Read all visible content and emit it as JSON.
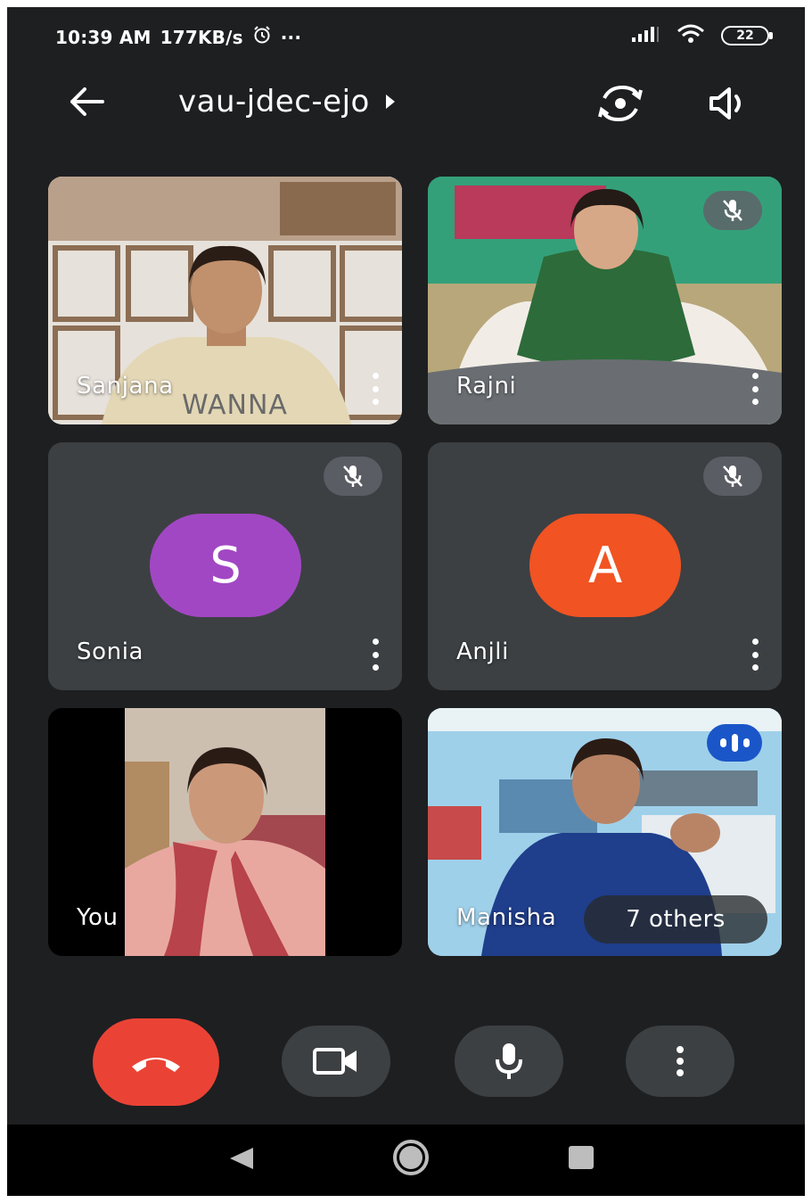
{
  "status_bar": {
    "time": "10:39 AM",
    "net_speed": "177KB/s",
    "more": "···",
    "battery": "22"
  },
  "top_bar": {
    "meeting_code": "vau-jdec-ejo"
  },
  "tiles": [
    {
      "name": "Sanjana",
      "shirt_text": "WANNA",
      "muted": false
    },
    {
      "name": "Rajni",
      "muted": true
    },
    {
      "name": "Sonia",
      "initial": "S",
      "avatar_color": "#a247c4",
      "muted": true
    },
    {
      "name": "Anjli",
      "initial": "A",
      "avatar_color": "#f15323",
      "muted": true
    },
    {
      "name": "You"
    },
    {
      "name": "Manisha",
      "speaking": true,
      "others_label": "7 others"
    }
  ],
  "colors": {
    "background": "#1e1f21",
    "tile": "#3c4043",
    "end_call": "#ea4335",
    "speaking": "#1a56c8"
  },
  "icons": {
    "back": "arrow-left-icon",
    "switch_camera": "camera-flip-icon",
    "speaker": "speaker-icon",
    "end_call": "phone-hangup-icon",
    "video": "video-camera-icon",
    "mic": "microphone-icon",
    "more": "more-vert-icon"
  }
}
